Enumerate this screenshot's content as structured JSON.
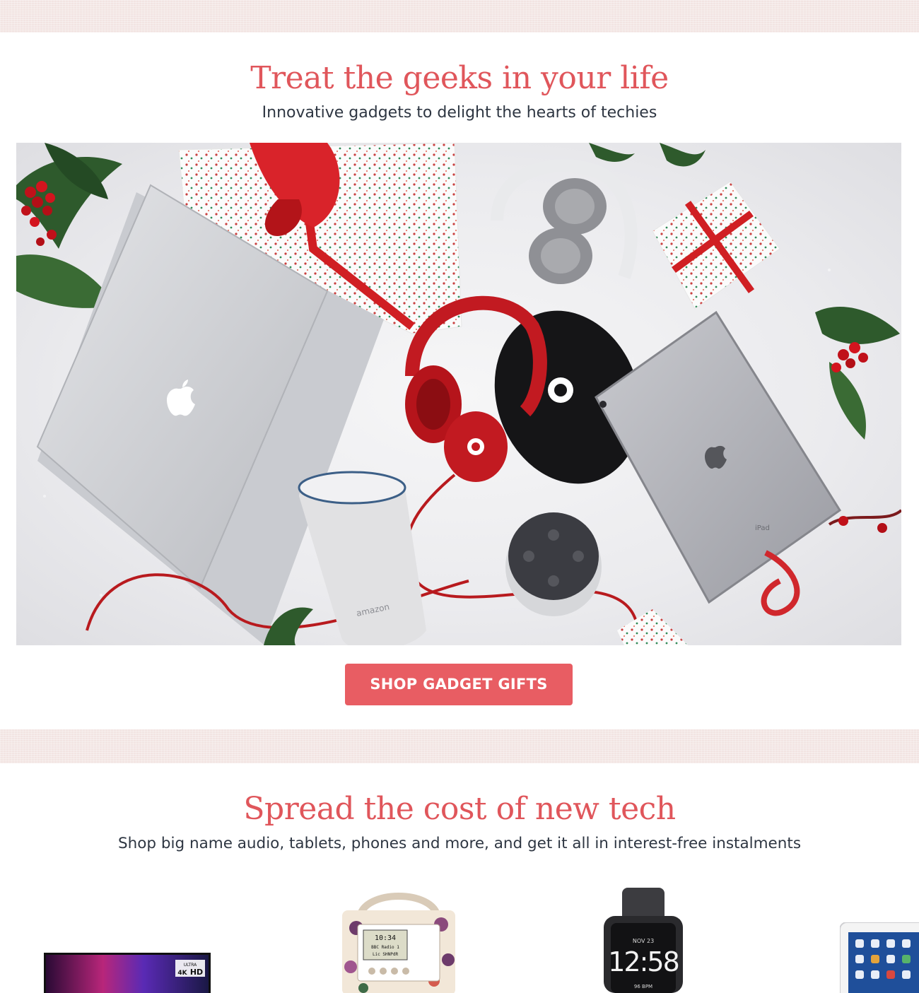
{
  "section_gadgets": {
    "headline": "Treat the geeks in your life",
    "subline": "Innovative gadgets to delight the hearts of techies",
    "cta_label": "SHOP GADGET GIFTS",
    "hero": {
      "laptop_logo": "apple-logo-icon",
      "tablet_label": "iPad",
      "speaker_label": "amazon"
    }
  },
  "section_tech": {
    "headline": "Spread the cost of new tech",
    "subline": "Shop big name audio, tablets, phones and more, and get it all in interest-free instalments",
    "products": [
      {
        "name": "tv",
        "badge_line1": "ULTRA",
        "badge_line2": "4K",
        "badge_line3": "HD"
      },
      {
        "name": "floral-radio",
        "screen_line1": "10:34",
        "screen_line2": "BBC Radio 1",
        "screen_line3": "Lic SHNPdR"
      },
      {
        "name": "smartwatch",
        "date": "NOV 23",
        "time": "12:58",
        "bpm": "96 BPM"
      },
      {
        "name": "tablet"
      }
    ]
  },
  "colors": {
    "accent": "#e0565b",
    "button": "#e85d63",
    "text": "#2e3642",
    "linen": "#f2e4e2"
  }
}
